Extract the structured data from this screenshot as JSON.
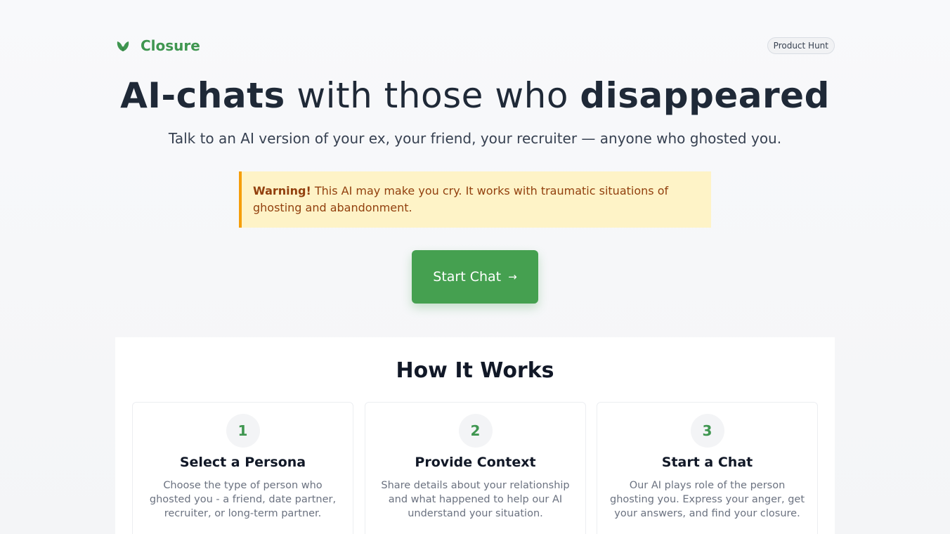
{
  "brand": {
    "icon": "leaf-icon",
    "name": "Closure",
    "color": "#3f9650"
  },
  "product_hunt_badge": "Product Hunt",
  "hero": {
    "title_part1": "AI-chats",
    "title_part2": " with those who ",
    "title_part3": "disappeared",
    "subtitle": "Talk to an AI version of your ex, your friend, your recruiter — anyone who ghosted you."
  },
  "warning": {
    "label": "Warning!",
    "text": " This AI may make you cry. It works with traumatic situations of ghosting and abandonment."
  },
  "cta": {
    "label": "Start Chat",
    "icon": "arrow-right-icon",
    "arrow": "→"
  },
  "how_it_works": {
    "title": "How It Works",
    "steps": [
      {
        "number": "1",
        "title": "Select a Persona",
        "description": "Choose the type of person who ghosted you - a friend, date partner, recruiter, or long-term partner."
      },
      {
        "number": "2",
        "title": "Provide Context",
        "description": "Share details about your relationship and what happened to help our AI understand your situation."
      },
      {
        "number": "3",
        "title": "Start a Chat",
        "description": "Our AI plays role of the person ghosting you. Express your anger, get your answers, and find your closure."
      }
    ]
  },
  "colors": {
    "accent": "#45a050",
    "warning_bg": "#fef3c7",
    "warning_border": "#f59e0b",
    "warning_text": "#92400e"
  }
}
